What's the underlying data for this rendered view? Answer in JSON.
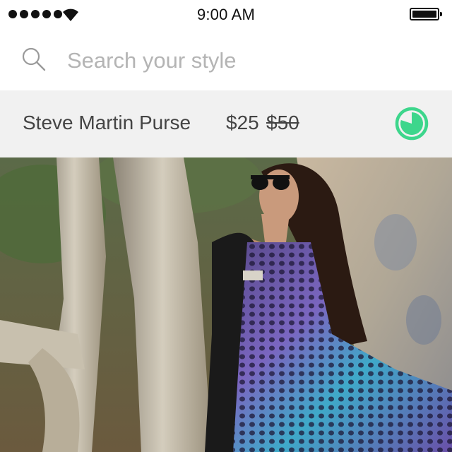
{
  "status_bar": {
    "time": "9:00 AM",
    "signal_icon": "signal-dots-icon",
    "wifi_icon": "wifi-icon",
    "battery_icon": "battery-full-icon"
  },
  "search": {
    "placeholder": "Search your style",
    "value": "",
    "icon": "search-icon"
  },
  "product": {
    "name": "Steve Martin Purse",
    "sale_price": "$25",
    "original_price": "$50",
    "timer_icon": "timer-icon",
    "timer_fraction_remaining": 0.8
  },
  "colors": {
    "accent": "#3dd68c",
    "product_bar_bg": "#f1f1f1",
    "placeholder": "#b4b4b4"
  },
  "photo": {
    "subject": "woman in sunglasses wearing tie-dye dress and black leather jacket in front of eucalyptus trees"
  }
}
